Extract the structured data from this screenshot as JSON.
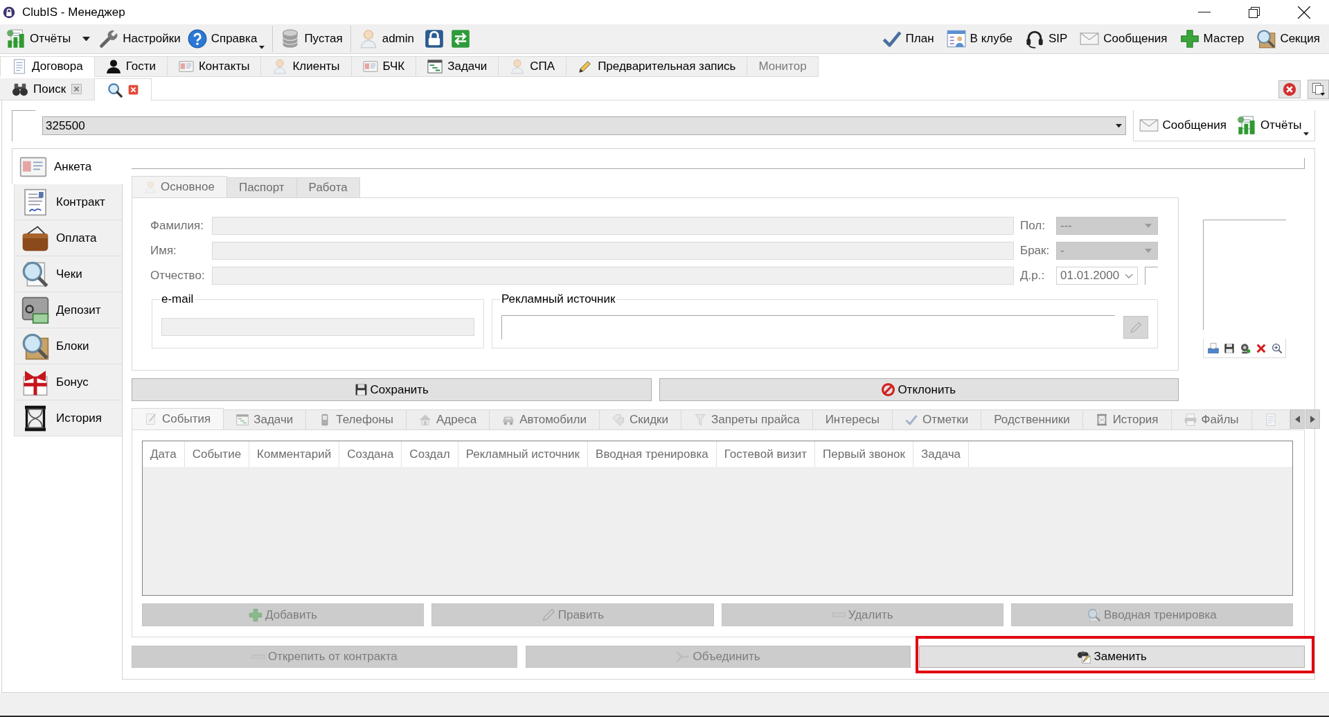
{
  "window": {
    "title": "ClubIS - Менеджер"
  },
  "toolbar": {
    "groups": [
      {
        "items": [
          {
            "label": "Отчёты",
            "kind": "split"
          },
          {
            "label": "Настройки",
            "kind": "plain"
          },
          {
            "label": "Справка",
            "kind": "menu"
          }
        ]
      },
      {
        "items": [
          {
            "label": "Пустая",
            "kind": "plain"
          }
        ]
      },
      {
        "items": [
          {
            "label": "admin",
            "kind": "plain"
          }
        ]
      }
    ],
    "right": [
      {
        "label": "План"
      },
      {
        "label": "В клубе"
      },
      {
        "label": "SIP"
      },
      {
        "label": "Сообщения"
      },
      {
        "label": "Мастер"
      },
      {
        "label": "Секция"
      }
    ]
  },
  "main_tabs": [
    {
      "label": "Договора",
      "selected": true,
      "disabled": false
    },
    {
      "label": "Гости",
      "selected": false,
      "disabled": false
    },
    {
      "label": "Контакты",
      "selected": false,
      "disabled": false
    },
    {
      "label": "Клиенты",
      "selected": false,
      "disabled": false
    },
    {
      "label": "БЧК",
      "selected": false,
      "disabled": false
    },
    {
      "label": "Задачи",
      "selected": false,
      "disabled": false
    },
    {
      "label": "СПА",
      "selected": false,
      "disabled": false
    },
    {
      "label": "Предварительная запись",
      "selected": false,
      "disabled": false
    },
    {
      "label": "Монитор",
      "selected": false,
      "disabled": true
    }
  ],
  "document_tabs": [
    {
      "label": "Поиск",
      "selected": false
    },
    {
      "selected": true
    }
  ],
  "search": {
    "value": "325500",
    "actions": [
      {
        "label": "Сообщения",
        "kind": "plain"
      },
      {
        "label": "Отчёты",
        "kind": "menu"
      }
    ]
  },
  "sidebar": {
    "items": [
      {
        "label": "Анкета",
        "selected": true
      },
      {
        "label": "Контракт",
        "selected": false
      },
      {
        "label": "Оплата",
        "selected": false
      },
      {
        "label": "Чеки",
        "selected": false
      },
      {
        "label": "Депозит",
        "selected": false
      },
      {
        "label": "Блоки",
        "selected": false
      },
      {
        "label": "Бонус",
        "selected": false
      },
      {
        "label": "История",
        "selected": false
      }
    ]
  },
  "form": {
    "disabled": true,
    "tabs": [
      {
        "label": "Основное",
        "selected": true
      },
      {
        "label": "Паспорт",
        "selected": false
      },
      {
        "label": "Работа",
        "selected": false
      }
    ],
    "name_fields": [
      {
        "label": "Фамилия:"
      },
      {
        "label": "Имя:"
      },
      {
        "label": "Отчество:"
      }
    ],
    "gender": {
      "label": "Пол:",
      "value": "---"
    },
    "marital_status": {
      "label": "Брак:",
      "value": "-"
    },
    "birth_date": {
      "label": "Д.р.:",
      "value": "01.01.2000"
    },
    "email": {
      "legend": "e-mail"
    },
    "ad_source": {
      "legend": "Рекламный источник"
    }
  },
  "actions": [
    {
      "label": "Сохранить",
      "disabled": false
    },
    {
      "label": "Отклонить",
      "disabled": false
    }
  ],
  "details": {
    "disabled": true,
    "tabs": [
      {
        "label": "События",
        "selected": true
      },
      {
        "label": "Задачи",
        "selected": false
      },
      {
        "label": "Телефоны",
        "selected": false
      },
      {
        "label": "Адреса",
        "selected": false
      },
      {
        "label": "Автомобили",
        "selected": false
      },
      {
        "label": "Скидки",
        "selected": false
      },
      {
        "label": "Запреты прайса",
        "selected": false
      },
      {
        "label": "Интересы",
        "selected": false
      },
      {
        "label": "Отметки",
        "selected": false
      },
      {
        "label": "Родственники",
        "selected": false
      },
      {
        "label": "История",
        "selected": false
      },
      {
        "label": "Файлы",
        "selected": false
      },
      {
        "selected": false
      }
    ],
    "table": {
      "columns": [
        "Дата",
        "Событие",
        "Комментарий",
        "Создана",
        "Создал",
        "Рекламный источник",
        "Вводная тренировка",
        "Гостевой визит",
        "Первый звонок",
        "Задача"
      ]
    },
    "buttons": [
      {
        "label": "Добавить",
        "disabled": true
      },
      {
        "label": "Править",
        "disabled": true
      },
      {
        "label": "Удалить",
        "disabled": true
      },
      {
        "label": "Вводная тренировка",
        "disabled": true
      }
    ]
  },
  "bottom_buttons": [
    {
      "label": "Открепить от контракта",
      "disabled": true,
      "highlighted": false
    },
    {
      "label": "Объединить",
      "disabled": true,
      "highlighted": false
    },
    {
      "label": "Заменить",
      "disabled": false,
      "highlighted": true
    }
  ]
}
